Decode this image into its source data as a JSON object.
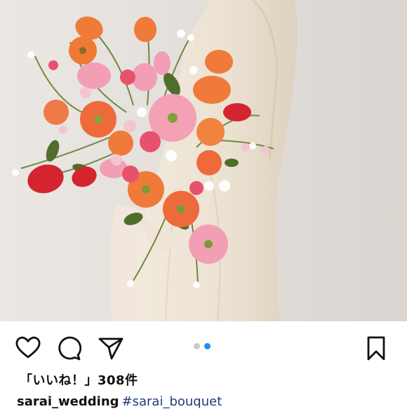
{
  "post": {
    "photo": {
      "subject": "bouquet-photo",
      "background_color": "#e6e2de",
      "dress_color": "#ede3d3",
      "flower_colors": [
        "#f07a3a",
        "#e8516e",
        "#f29fb6",
        "#d4242f",
        "#f4c5cf",
        "#ffffff"
      ]
    },
    "actions": {
      "like_icon": "heart-icon",
      "comment_icon": "comment-icon",
      "share_icon": "send-icon",
      "save_icon": "bookmark-icon"
    },
    "carousel": {
      "total": 2,
      "active_index": 2,
      "active_color": "#1e90ef",
      "inactive_color": "#c9c9c9"
    },
    "likes_text": "「いいね！」308件",
    "caption": {
      "username": "sarai_wedding",
      "hashtag": "#sarai_bouquet"
    }
  }
}
